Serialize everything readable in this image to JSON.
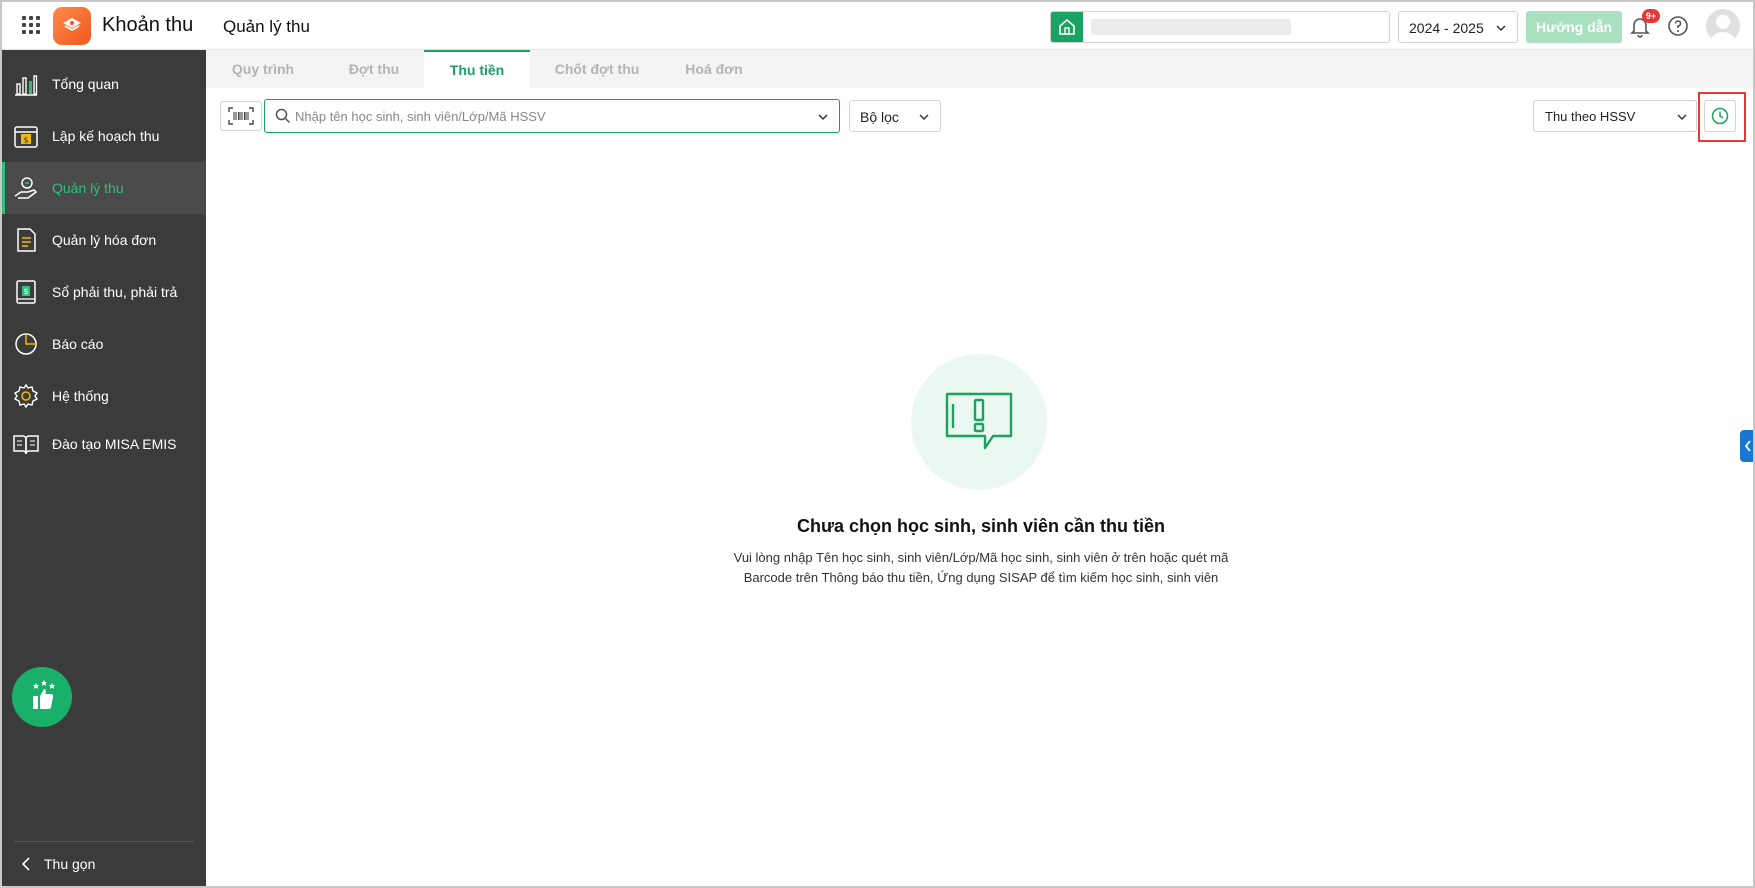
{
  "header": {
    "app_title": "Khoản thu",
    "page_title": "Quản lý thu",
    "school_year": "2024 - 2025",
    "guide_label": "Hướng dẫn",
    "notification_badge": "9+"
  },
  "sidebar": {
    "items": [
      {
        "label": "Tổng quan",
        "icon": "chart-bars-icon"
      },
      {
        "label": "Lập kế hoạch thu",
        "icon": "calendar-dollar-icon"
      },
      {
        "label": "Quản lý thu",
        "icon": "hand-coin-icon",
        "active": true
      },
      {
        "label": "Quản lý hóa đơn",
        "icon": "invoice-icon"
      },
      {
        "label": "Sổ phải thu, phải trả",
        "icon": "ledger-book-icon"
      },
      {
        "label": "Báo cáo",
        "icon": "pie-chart-icon"
      },
      {
        "label": "Hệ thống",
        "icon": "gear-icon"
      },
      {
        "label": "Đào tạo MISA EMIS",
        "icon": "open-book-icon"
      }
    ],
    "collapse_label": "Thu gọn"
  },
  "tabs": [
    {
      "label": "Quy trình"
    },
    {
      "label": "Đợt thu"
    },
    {
      "label": "Thu tiền",
      "active": true
    },
    {
      "label": "Chốt đợt thu"
    },
    {
      "label": "Hoá đơn"
    }
  ],
  "toolbar": {
    "search_placeholder": "Nhập tên học sinh, sinh viên/Lớp/Mã HSSV",
    "filter_label": "Bộ lọc",
    "mode_label": "Thu theo HSSV"
  },
  "empty_state": {
    "title": "Chưa chọn học sinh, sinh viên cần thu tiền",
    "line1": "Vui lòng nhập Tên học sinh, sinh viên/Lớp/Mã học sinh, sinh viên ở trên hoặc quét mã",
    "line2": "Barcode trên Thông báo thu tiền, Ứng dụng SISAP để tìm kiếm học sinh, sinh viên"
  },
  "colors": {
    "accent": "#1aa260",
    "sidebar_bg": "#3b3b3b",
    "highlight": "#e53935"
  }
}
